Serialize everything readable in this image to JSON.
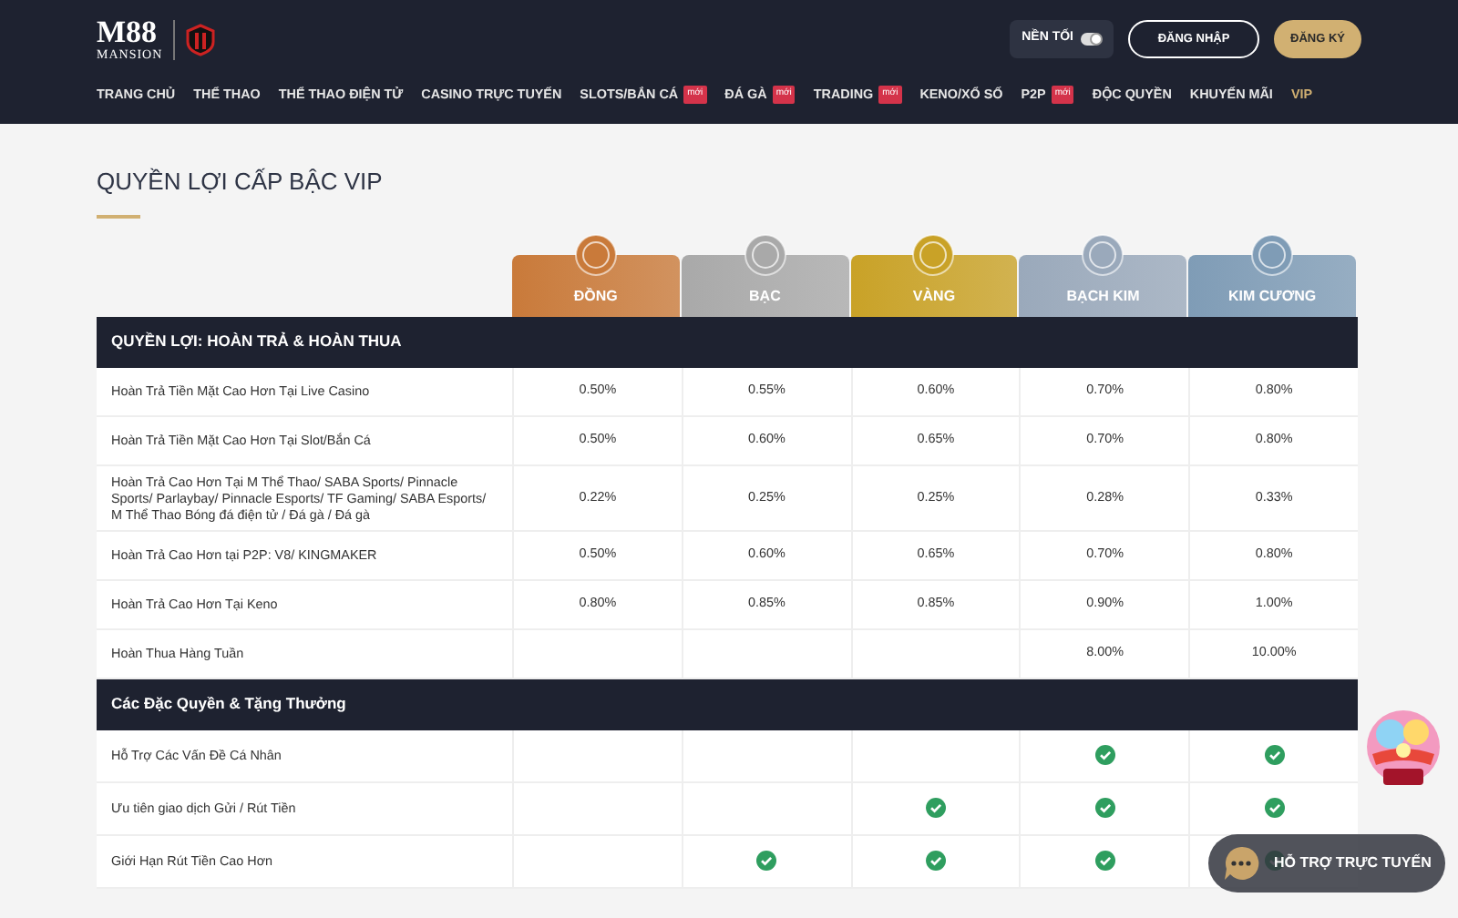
{
  "header": {
    "logo": {
      "text": "M88",
      "subtext": "MANSION"
    },
    "theme_toggle": {
      "label": "NỀN TỐI",
      "on": true
    },
    "buttons": [
      {
        "label": "ĐĂNG NHẬP",
        "kind": "outline"
      },
      {
        "label": "ĐĂNG KÝ",
        "kind": "gold"
      }
    ],
    "nav": [
      {
        "label": "TRANG CHỦ",
        "selected": false
      },
      {
        "label": "THỂ THAO",
        "selected": false
      },
      {
        "label": "THỂ THAO ĐIỆN TỬ",
        "selected": false
      },
      {
        "label": "CASINO TRỰC TUYẾN",
        "selected": false
      },
      {
        "label": "SLOTS/BẮN CÁ",
        "badge": "mới",
        "selected": false
      },
      {
        "label": "ĐÁ GÀ",
        "badge": "mới",
        "selected": false
      },
      {
        "label": "TRADING",
        "badge": "mới",
        "selected": false
      },
      {
        "label": "KENO/XỔ SỐ",
        "selected": false
      },
      {
        "label": "P2P",
        "badge": "mới",
        "selected": false
      },
      {
        "label": "ĐỘC QUYỀN",
        "selected": false
      },
      {
        "label": "KHUYẾN MÃI",
        "selected": false
      },
      {
        "label": "VIP",
        "selected": true
      }
    ]
  },
  "page_title": "QUYỀN LỢI CẤP BẬC VIP",
  "tiers": [
    {
      "name": "ĐỒNG",
      "color": "#c97a3a"
    },
    {
      "name": "BẠC",
      "color": "#a9a9a9"
    },
    {
      "name": "VÀNG",
      "color": "#c9a227"
    },
    {
      "name": "BẠCH KIM",
      "color": "#9aa9bb"
    },
    {
      "name": "KIM CƯƠNG",
      "color": "#7f9cb6"
    }
  ],
  "sections": [
    {
      "title": "QUYỀN LỢI: HOÀN TRẢ & HOÀN THUA",
      "kind": "values",
      "rows": [
        {
          "label": "Hoàn Trả Tiền Mặt Cao Hơn Tại Live Casino",
          "cells": [
            {
              "value": "0.50%"
            },
            {
              "value": "0.55%"
            },
            {
              "value": "0.60%"
            },
            {
              "value": "0.70%"
            },
            {
              "value": "0.80%"
            }
          ]
        },
        {
          "label": "Hoàn Trả Tiền Mặt Cao Hơn Tại Slot/Bắn Cá",
          "cells": [
            {
              "value": "0.50%"
            },
            {
              "value": "0.60%"
            },
            {
              "value": "0.65%"
            },
            {
              "value": "0.70%"
            },
            {
              "value": "0.80%"
            }
          ]
        },
        {
          "label": "Hoàn Trả Cao Hơn Tại M Thể Thao/ SABA Sports/ Pinnacle Sports/ Parlaybay/ Pinnacle Esports/ TF Gaming/ SABA Esports/ M Thể Thao Bóng đá điện tử / Đá gà / Đá gà",
          "cells": [
            {
              "value": "0.22%"
            },
            {
              "value": "0.25%"
            },
            {
              "value": "0.25%"
            },
            {
              "value": "0.28%"
            },
            {
              "value": "0.33%"
            }
          ]
        },
        {
          "label": "Hoàn Trả Cao Hơn tại P2P: V8/ KINGMAKER",
          "cells": [
            {
              "value": "0.50%"
            },
            {
              "value": "0.60%"
            },
            {
              "value": "0.65%"
            },
            {
              "value": "0.70%"
            },
            {
              "value": "0.80%"
            }
          ]
        },
        {
          "label": "Hoàn Trả Cao Hơn Tại Keno",
          "cells": [
            {
              "value": "0.80%"
            },
            {
              "value": "0.85%"
            },
            {
              "value": "0.85%"
            },
            {
              "value": "0.90%"
            },
            {
              "value": "1.00%"
            }
          ]
        },
        {
          "label": "Hoàn Thua Hàng Tuần",
          "cells": [
            {},
            {},
            {},
            {
              "value": "8.00%"
            },
            {
              "value": "10.00%"
            }
          ]
        }
      ]
    },
    {
      "title": "Các Đặc Quyền & Tặng Thưởng",
      "kind": "checks",
      "rows": [
        {
          "label": "Hỗ Trợ Các Vấn Đề Cá Nhân",
          "checks": [
            false,
            false,
            false,
            true,
            true
          ]
        },
        {
          "label": "Ưu tiên giao dịch Gửi / Rút Tiền",
          "checks": [
            false,
            false,
            true,
            true,
            true
          ]
        },
        {
          "label": "Giới Hạn Rút Tiền Cao Hơn",
          "checks": [
            false,
            true,
            true,
            true,
            true
          ]
        }
      ]
    }
  ],
  "chat_button": {
    "label": "HỖ TRỢ TRỰC TUYẾN"
  }
}
